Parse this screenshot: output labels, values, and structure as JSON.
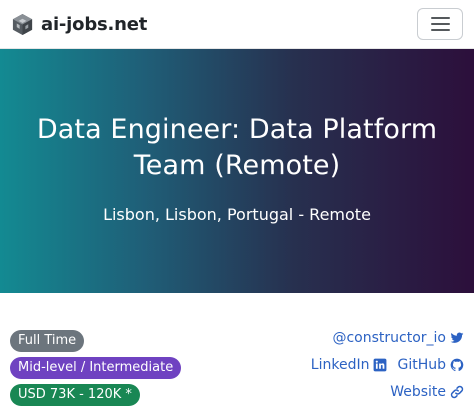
{
  "navbar": {
    "brand": "ai-jobs.net",
    "brand_icon": "cube-logo-icon",
    "menu_icon": "hamburger-menu-icon"
  },
  "hero": {
    "title": "Data Engineer: Data Platform Team (Remote)",
    "location": "Lisbon, Lisbon, Portugal - Remote",
    "gradient_colors": [
      "#138a92",
      "#27304f",
      "#2c0f3b"
    ]
  },
  "badges": {
    "employment_type": "Full Time",
    "level": "Mid-level / Intermediate",
    "salary": "USD 73K - 120K *",
    "colors": {
      "employment_type": "#6c757d",
      "level": "#6f42c1",
      "salary": "#198754"
    }
  },
  "links": {
    "twitter": "@constructor_io",
    "linkedin": "LinkedIn",
    "github": "GitHub",
    "website": "Website",
    "color": "#2c62c3"
  }
}
